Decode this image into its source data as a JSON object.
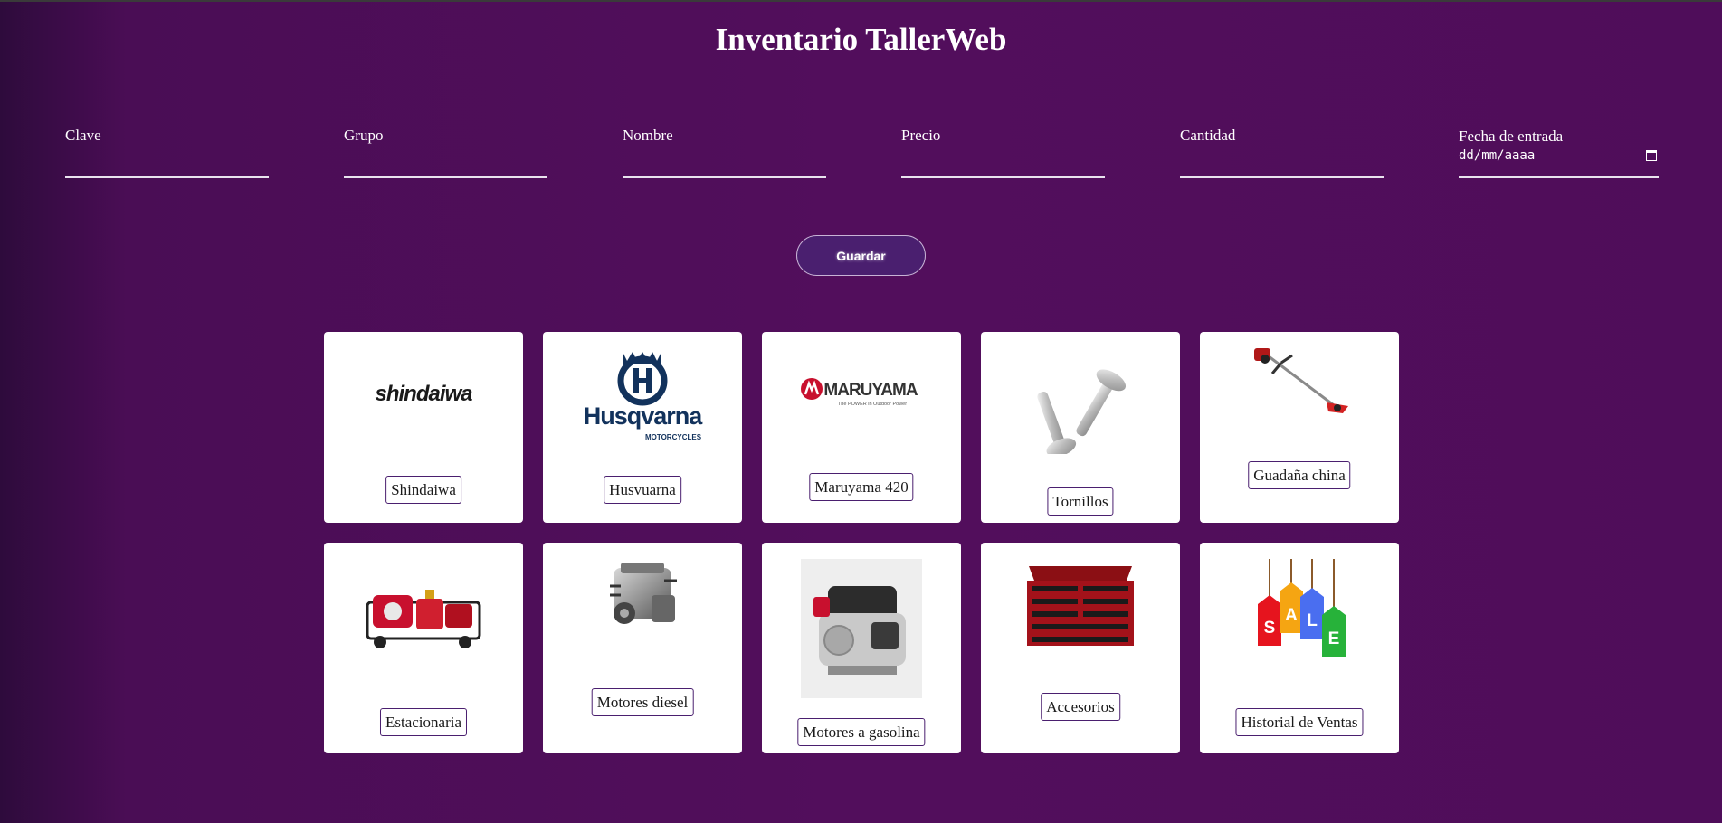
{
  "title": "Inventario TallerWeb",
  "form": {
    "fields": [
      {
        "label": "Clave"
      },
      {
        "label": "Grupo"
      },
      {
        "label": "Nombre"
      },
      {
        "label": "Precio"
      },
      {
        "label": "Cantidad"
      },
      {
        "label": "Fecha de entrada",
        "placeholder": "dd/mm/aaaa"
      }
    ],
    "save_label": "Guardar"
  },
  "cards": [
    {
      "label": "Shindaiwa",
      "icon": "shindaiwa-logo",
      "logo_text": "shindaiwa"
    },
    {
      "label": "Husvuarna",
      "icon": "husqvarna-logo",
      "logo_text": "Husqvarna",
      "logo_sub": "MOTORCYCLES"
    },
    {
      "label": "Maruyama 420",
      "icon": "maruyama-logo",
      "logo_text": "MARUYAMA",
      "logo_sub": "The POWER in Outdoor Power"
    },
    {
      "label": "Tornillos",
      "icon": "screws-image"
    },
    {
      "label": "Guadaña china",
      "icon": "brush-cutter-image"
    },
    {
      "label": "Estacionaria",
      "icon": "stationary-sprayer-image"
    },
    {
      "label": "Motores diesel",
      "icon": "diesel-engine-image"
    },
    {
      "label": "Motores a gasolina",
      "icon": "gasoline-engine-image"
    },
    {
      "label": "Accesorios",
      "icon": "toolbox-image"
    },
    {
      "label": "Historial de Ventas",
      "icon": "sale-tags-image",
      "tags": [
        "S",
        "A",
        "L",
        "E"
      ]
    }
  ],
  "colors": {
    "background": "#520e5c",
    "button": "#4a1f6f",
    "card": "#ffffff"
  }
}
